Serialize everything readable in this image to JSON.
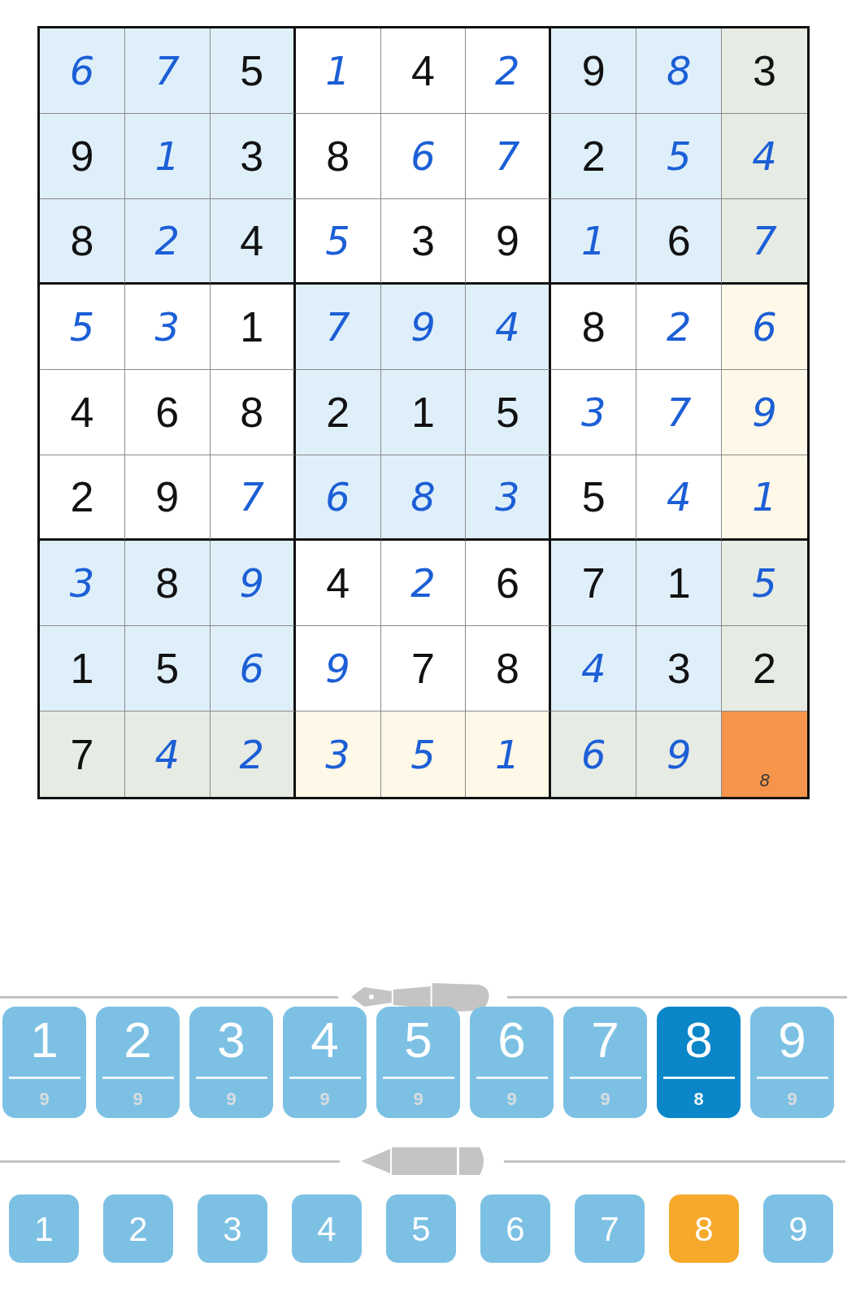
{
  "grid": [
    [
      {
        "value": "6",
        "kind": "entered",
        "color": "#dfeffa"
      },
      {
        "value": "7",
        "kind": "entered",
        "color": "#dfeffa"
      },
      {
        "value": "5",
        "kind": "given",
        "color": "#dfeffa"
      },
      {
        "value": "1",
        "kind": "entered",
        "color": "#ffffff"
      },
      {
        "value": "4",
        "kind": "given",
        "color": "#ffffff"
      },
      {
        "value": "2",
        "kind": "entered",
        "color": "#ffffff"
      },
      {
        "value": "9",
        "kind": "given",
        "color": "#dfeffa"
      },
      {
        "value": "8",
        "kind": "entered",
        "color": "#dfeffa"
      },
      {
        "value": "3",
        "kind": "given",
        "color": "#e6ebe4"
      }
    ],
    [
      {
        "value": "9",
        "kind": "given",
        "color": "#dfeffa"
      },
      {
        "value": "1",
        "kind": "entered",
        "color": "#dfeffa"
      },
      {
        "value": "3",
        "kind": "given",
        "color": "#dfeffa"
      },
      {
        "value": "8",
        "kind": "given",
        "color": "#ffffff"
      },
      {
        "value": "6",
        "kind": "entered",
        "color": "#ffffff"
      },
      {
        "value": "7",
        "kind": "entered",
        "color": "#ffffff"
      },
      {
        "value": "2",
        "kind": "given",
        "color": "#dfeffa"
      },
      {
        "value": "5",
        "kind": "entered",
        "color": "#dfeffa"
      },
      {
        "value": "4",
        "kind": "entered",
        "color": "#e6ebe4"
      }
    ],
    [
      {
        "value": "8",
        "kind": "given",
        "color": "#dfeffa"
      },
      {
        "value": "2",
        "kind": "entered",
        "color": "#dfeffa"
      },
      {
        "value": "4",
        "kind": "given",
        "color": "#dfeffa"
      },
      {
        "value": "5",
        "kind": "entered",
        "color": "#ffffff"
      },
      {
        "value": "3",
        "kind": "given",
        "color": "#ffffff"
      },
      {
        "value": "9",
        "kind": "given",
        "color": "#ffffff"
      },
      {
        "value": "1",
        "kind": "entered",
        "color": "#dfeffa"
      },
      {
        "value": "6",
        "kind": "given",
        "color": "#dfeffa"
      },
      {
        "value": "7",
        "kind": "entered",
        "color": "#e6ebe4"
      }
    ],
    [
      {
        "value": "5",
        "kind": "entered",
        "color": "#ffffff"
      },
      {
        "value": "3",
        "kind": "entered",
        "color": "#ffffff"
      },
      {
        "value": "1",
        "kind": "given",
        "color": "#ffffff"
      },
      {
        "value": "7",
        "kind": "entered",
        "color": "#dfeffa"
      },
      {
        "value": "9",
        "kind": "entered",
        "color": "#dfeffa"
      },
      {
        "value": "4",
        "kind": "entered",
        "color": "#dfeffa"
      },
      {
        "value": "8",
        "kind": "given",
        "color": "#ffffff"
      },
      {
        "value": "2",
        "kind": "entered",
        "color": "#ffffff"
      },
      {
        "value": "6",
        "kind": "entered",
        "color": "#fdf8e7"
      }
    ],
    [
      {
        "value": "4",
        "kind": "given",
        "color": "#ffffff"
      },
      {
        "value": "6",
        "kind": "given",
        "color": "#ffffff"
      },
      {
        "value": "8",
        "kind": "given",
        "color": "#ffffff"
      },
      {
        "value": "2",
        "kind": "given",
        "color": "#dfeffa"
      },
      {
        "value": "1",
        "kind": "given",
        "color": "#dfeffa"
      },
      {
        "value": "5",
        "kind": "given",
        "color": "#dfeffa"
      },
      {
        "value": "3",
        "kind": "entered",
        "color": "#ffffff"
      },
      {
        "value": "7",
        "kind": "entered",
        "color": "#ffffff"
      },
      {
        "value": "9",
        "kind": "entered",
        "color": "#fdf8e7"
      }
    ],
    [
      {
        "value": "2",
        "kind": "given",
        "color": "#ffffff"
      },
      {
        "value": "9",
        "kind": "given",
        "color": "#ffffff"
      },
      {
        "value": "7",
        "kind": "entered",
        "color": "#ffffff"
      },
      {
        "value": "6",
        "kind": "entered",
        "color": "#dfeffa"
      },
      {
        "value": "8",
        "kind": "entered",
        "color": "#dfeffa"
      },
      {
        "value": "3",
        "kind": "entered",
        "color": "#dfeffa"
      },
      {
        "value": "5",
        "kind": "given",
        "color": "#ffffff"
      },
      {
        "value": "4",
        "kind": "entered",
        "color": "#ffffff"
      },
      {
        "value": "1",
        "kind": "entered",
        "color": "#fdf8e7"
      }
    ],
    [
      {
        "value": "3",
        "kind": "entered",
        "color": "#dfeffa"
      },
      {
        "value": "8",
        "kind": "given",
        "color": "#dfeffa"
      },
      {
        "value": "9",
        "kind": "entered",
        "color": "#dfeffa"
      },
      {
        "value": "4",
        "kind": "given",
        "color": "#ffffff"
      },
      {
        "value": "2",
        "kind": "entered",
        "color": "#ffffff"
      },
      {
        "value": "6",
        "kind": "given",
        "color": "#ffffff"
      },
      {
        "value": "7",
        "kind": "given",
        "color": "#dfeffa"
      },
      {
        "value": "1",
        "kind": "given",
        "color": "#dfeffa"
      },
      {
        "value": "5",
        "kind": "entered",
        "color": "#e6ebe4"
      }
    ],
    [
      {
        "value": "1",
        "kind": "given",
        "color": "#dfeffa"
      },
      {
        "value": "5",
        "kind": "given",
        "color": "#dfeffa"
      },
      {
        "value": "6",
        "kind": "entered",
        "color": "#dfeffa"
      },
      {
        "value": "9",
        "kind": "entered",
        "color": "#ffffff"
      },
      {
        "value": "7",
        "kind": "given",
        "color": "#ffffff"
      },
      {
        "value": "8",
        "kind": "given",
        "color": "#ffffff"
      },
      {
        "value": "4",
        "kind": "entered",
        "color": "#dfeffa"
      },
      {
        "value": "3",
        "kind": "given",
        "color": "#dfeffa"
      },
      {
        "value": "2",
        "kind": "given",
        "color": "#e6ebe4"
      }
    ],
    [
      {
        "value": "7",
        "kind": "given",
        "color": "#e6ebe4"
      },
      {
        "value": "4",
        "kind": "entered",
        "color": "#e6ebe4"
      },
      {
        "value": "2",
        "kind": "entered",
        "color": "#e6ebe4"
      },
      {
        "value": "3",
        "kind": "entered",
        "color": "#fdf8e7"
      },
      {
        "value": "5",
        "kind": "entered",
        "color": "#fdf8e7"
      },
      {
        "value": "1",
        "kind": "entered",
        "color": "#fdf8e7"
      },
      {
        "value": "6",
        "kind": "entered",
        "color": "#e6ebe4"
      },
      {
        "value": "9",
        "kind": "entered",
        "color": "#e6ebe4"
      },
      {
        "value": "8",
        "kind": "note",
        "color": "#f7944b"
      }
    ]
  ],
  "pen_buttons": [
    {
      "digit": "1",
      "count": "9",
      "selected": false
    },
    {
      "digit": "2",
      "count": "9",
      "selected": false
    },
    {
      "digit": "3",
      "count": "9",
      "selected": false
    },
    {
      "digit": "4",
      "count": "9",
      "selected": false
    },
    {
      "digit": "5",
      "count": "9",
      "selected": false
    },
    {
      "digit": "6",
      "count": "9",
      "selected": false
    },
    {
      "digit": "7",
      "count": "9",
      "selected": false
    },
    {
      "digit": "8",
      "count": "8",
      "selected": true
    },
    {
      "digit": "9",
      "count": "9",
      "selected": false
    }
  ],
  "pencil_buttons": [
    {
      "digit": "1",
      "selected": false
    },
    {
      "digit": "2",
      "selected": false
    },
    {
      "digit": "3",
      "selected": false
    },
    {
      "digit": "4",
      "selected": false
    },
    {
      "digit": "5",
      "selected": false
    },
    {
      "digit": "6",
      "selected": false
    },
    {
      "digit": "7",
      "selected": false
    },
    {
      "digit": "8",
      "selected": true
    },
    {
      "digit": "9",
      "selected": false
    }
  ]
}
